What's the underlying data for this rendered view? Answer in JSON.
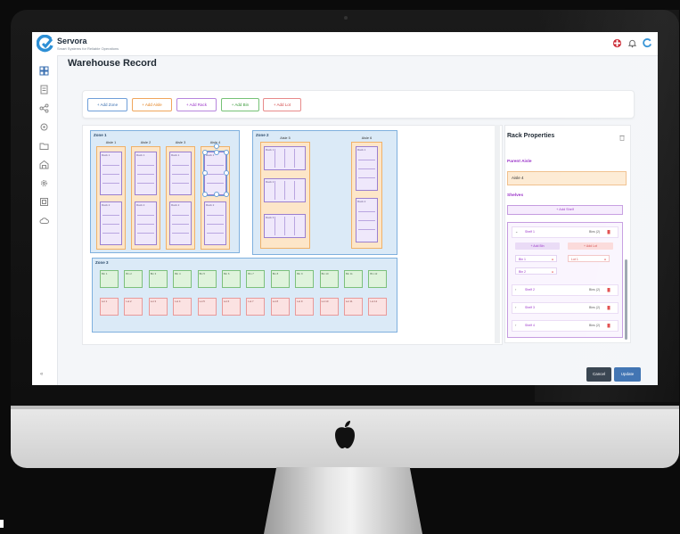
{
  "app": {
    "brand_name": "Servora",
    "brand_tagline": "Smart Systems for Reliable Operations",
    "page_title": "Warehouse Record",
    "accent": "#3a6fb0"
  },
  "topbar": {
    "icons": [
      "flag-icon",
      "bell-icon",
      "servora-logo-icon"
    ]
  },
  "sidebar": {
    "icons": [
      "dashboard-icon",
      "list-icon",
      "share-icon",
      "settings-icon",
      "folder-icon",
      "warehouse-icon",
      "gear-icon",
      "document-icon",
      "cloud-icon"
    ]
  },
  "toolbar": {
    "add_zone": "+ Add Zone",
    "add_aisle": "+ Add Aisle",
    "add_rack": "+ Add Rack",
    "add_bin": "+ Add Bin",
    "add_lot": "+ Add Lot"
  },
  "zones": {
    "zone1": {
      "label": "Zone 1",
      "aisles": [
        {
          "label": "Aisle 1",
          "racks": [
            "Rack 1",
            "Rack 2"
          ]
        },
        {
          "label": "Aisle 2",
          "racks": [
            "Rack 1",
            "Rack 2"
          ]
        },
        {
          "label": "Aisle 3",
          "racks": [
            "Rack 1",
            "Rack 2"
          ]
        },
        {
          "label": "Aisle 4",
          "racks": [
            "Rack 1",
            "Rack 2"
          ]
        }
      ]
    },
    "zone2": {
      "label": "Zone 2",
      "aisles": [
        {
          "label": "Aisle 5",
          "racks": [
            "Rack 1",
            "Rack 2",
            "Rack 3"
          ]
        },
        {
          "label": "Aisle 6",
          "racks": [
            "Rack 1",
            "Rack 2"
          ]
        }
      ]
    },
    "zone3": {
      "label": "Zone 3",
      "bins": [
        "Bin 1",
        "Bin 2",
        "Bin 3",
        "Bin 4",
        "Bin 5",
        "Bin 6",
        "Bin 7",
        "Bin 8",
        "Bin 9",
        "Bin 10",
        "Bin 11",
        "Bin 12"
      ],
      "lots": [
        "Lot 1",
        "Lot 2",
        "Lot 3",
        "Lot 4",
        "Lot 5",
        "Lot 6",
        "Lot 7",
        "Lot 8",
        "Lot 9",
        "Lot 10",
        "Lot 11",
        "Lot 12"
      ]
    }
  },
  "panel": {
    "title": "Rack Properties",
    "parent_aisle_label": "Parent Aisle",
    "parent_aisle_value": "Aisle 4",
    "shelves_label": "Shelves",
    "add_shelf": "+ Add Shelf",
    "shelves": [
      {
        "name": "Shelf 1",
        "count": "Bins (2)",
        "expanded": true
      },
      {
        "name": "Shelf 2",
        "count": "Bins (2)",
        "expanded": false
      },
      {
        "name": "Shelf 3",
        "count": "Bins (2)",
        "expanded": false
      },
      {
        "name": "Shelf 4",
        "count": "Bins (2)",
        "expanded": false
      }
    ],
    "add_bin": "+ Add Bin",
    "add_lot": "+ Add Lot",
    "bin_chips": [
      "Bin 1",
      "Bin 2"
    ],
    "lot_chips": [
      "Lot 1"
    ]
  },
  "footer": {
    "cancel": "Cancel",
    "update": "Update"
  }
}
